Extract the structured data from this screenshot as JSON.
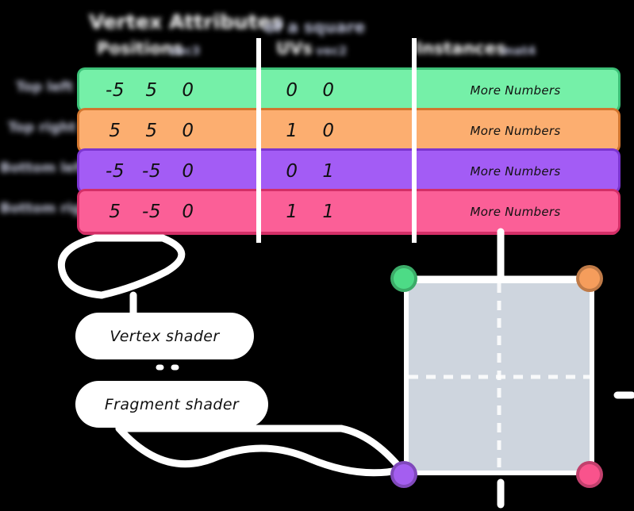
{
  "header": {
    "title_main": "Vertex Attributes",
    "title_sub": "of a square",
    "columns": [
      {
        "label": "Positions",
        "badge": "vec3"
      },
      {
        "label": "UVs",
        "badge": "vec2"
      },
      {
        "label": "Instances",
        "badge": "mat4"
      }
    ]
  },
  "table": {
    "rows": [
      {
        "name": "Top left",
        "color": "#75f0a8",
        "edge": "#3cc077",
        "position": [
          "-5",
          "5",
          "0"
        ],
        "uv": [
          "0",
          "0"
        ],
        "more": "More Numbers"
      },
      {
        "name": "Top right",
        "color": "#fcae70",
        "edge": "#d2762f",
        "position": [
          "5",
          "5",
          "0"
        ],
        "uv": [
          "1",
          "0"
        ],
        "more": "More Numbers"
      },
      {
        "name": "Bottom left",
        "color": "#a濃",
        "position": [
          "-5",
          "-5",
          "0"
        ],
        "uv": [
          "0",
          "1"
        ],
        "more": "More Numbers"
      },
      {
        "name": "Bottom right",
        "color": "#fb5f97",
        "edge": "#d42f67",
        "position": [
          "5",
          "-5",
          "0"
        ],
        "uv": [
          "1",
          "1"
        ],
        "more": "More Numbers"
      }
    ]
  },
  "shaders": {
    "vertex": "Vertex shader",
    "fragment": "Fragment shader"
  },
  "quad": {
    "fill": "#ced5de",
    "corners": [
      {
        "name": "top-left",
        "color": "#4ddb86"
      },
      {
        "name": "top-right",
        "color": "#f59d5c"
      },
      {
        "name": "bottom-left",
        "color": "#a45ef0"
      },
      {
        "name": "bottom-right",
        "color": "#f9538c"
      }
    ]
  }
}
